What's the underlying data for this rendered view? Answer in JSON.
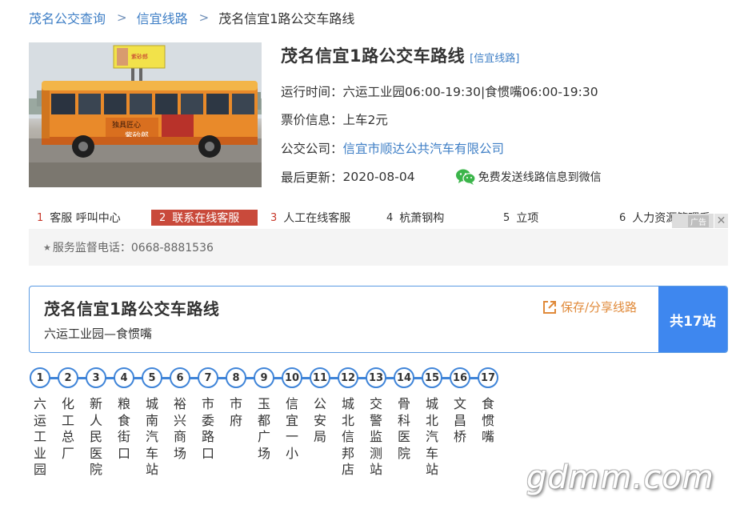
{
  "breadcrumb": {
    "items": [
      "茂名公交查询",
      "信宜线路",
      "茂名信宜1路公交车路线"
    ],
    "separator": ">"
  },
  "photo": {
    "billboard_text": "紫砂郎",
    "bus_text_1": "独具匠心",
    "bus_text_2": "紫砂郎"
  },
  "info": {
    "title": "茂名信宜1路公交车路线",
    "tag": "[信宜线路]",
    "hours_label": "运行时间：",
    "hours_value": "六运工业园06:00-19:30|食惯嘴06:00-19:30",
    "fare_label": "票价信息：",
    "fare_value": "上车2元",
    "company_label": "公交公司：",
    "company_value": "信宜市顺达公共汽车有限公司",
    "updated_label": "最后更新：",
    "updated_value": "2020-08-04",
    "wechat_text": "免费发送线路信息到微信"
  },
  "ad_menu": {
    "items": [
      {
        "num": "1",
        "label": "客服 呼叫中心"
      },
      {
        "num": "2",
        "label": "联系在线客服",
        "active": true
      },
      {
        "num": "3",
        "label": "人工在线客服"
      },
      {
        "num": "4",
        "label": "杭萧钢构"
      },
      {
        "num": "5",
        "label": "立项"
      },
      {
        "num": "6",
        "label": "人力资源管理系"
      }
    ],
    "close_label": "广告",
    "close_symbol": "✕"
  },
  "service": {
    "star": "★",
    "text": "服务监督电话：0668-8881536"
  },
  "route_card": {
    "title": "茂名信宜1路公交车路线",
    "subtitle": "六运工业园—食惯嘴",
    "share_label": "保存/分享线路",
    "station_count": "共17站"
  },
  "stations": [
    {
      "num": "1",
      "name": "六运工业园"
    },
    {
      "num": "2",
      "name": "化工总厂"
    },
    {
      "num": "3",
      "name": "新人民医院"
    },
    {
      "num": "4",
      "name": "粮食街口"
    },
    {
      "num": "5",
      "name": "城南汽车站"
    },
    {
      "num": "6",
      "name": "裕兴商场"
    },
    {
      "num": "7",
      "name": "市委路口"
    },
    {
      "num": "8",
      "name": "市府"
    },
    {
      "num": "9",
      "name": "玉都广场"
    },
    {
      "num": "10",
      "name": "信宜一小"
    },
    {
      "num": "11",
      "name": "公安局"
    },
    {
      "num": "12",
      "name": "城北信邦店"
    },
    {
      "num": "13",
      "name": "交警监测站"
    },
    {
      "num": "14",
      "name": "骨科医院"
    },
    {
      "num": "15",
      "name": "城北汽车站"
    },
    {
      "num": "16",
      "name": "文昌桥"
    },
    {
      "num": "17",
      "name": "食惯嘴"
    }
  ],
  "watermark": "gdmm.com",
  "colors": {
    "link": "#3f7fc6",
    "accent_blue": "#3e87ef",
    "active_red": "#c94a3b",
    "share_orange": "#e08a3a",
    "wechat_green": "#3bb54a"
  }
}
